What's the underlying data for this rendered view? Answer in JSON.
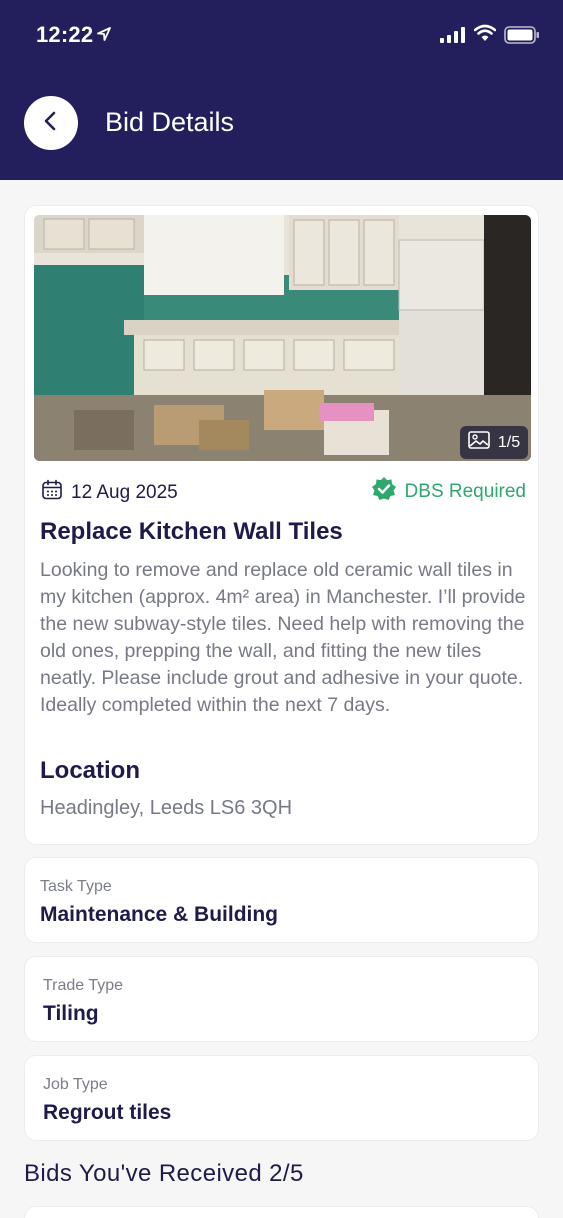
{
  "status_bar": {
    "time": "12:22",
    "icons": [
      "location-arrow-icon",
      "cellular-signal-icon",
      "wifi-icon",
      "battery-icon"
    ]
  },
  "header": {
    "title": "Bid Details",
    "back_icon": "chevron-left-icon",
    "background_color": "#231f5c"
  },
  "job": {
    "photo_counter": "1/5",
    "date": "12 Aug 2025",
    "badge": "DBS Required",
    "badge_color": "#2fa86e",
    "title": "Replace Kitchen Wall Tiles",
    "description": "Looking to remove and replace old ceramic wall tiles in my kitchen (approx. 4m² area) in Manchester. I’ll provide the new subway-style tiles. Need help with removing the old ones, prepping the wall, and fitting the new tiles neatly. Please include grout and adhesive in your quote. Ideally completed within the next 7 days.",
    "location_heading": "Location",
    "location": "Headingley, Leeds LS6 3QH"
  },
  "details": [
    {
      "label": "Task Type",
      "value": "Maintenance & Building"
    },
    {
      "label": "Trade Type",
      "value": "Tiling"
    },
    {
      "label": "Job Type",
      "value": "Regrout tiles"
    }
  ],
  "bids": {
    "heading": "Bids You've Received 2/5"
  }
}
